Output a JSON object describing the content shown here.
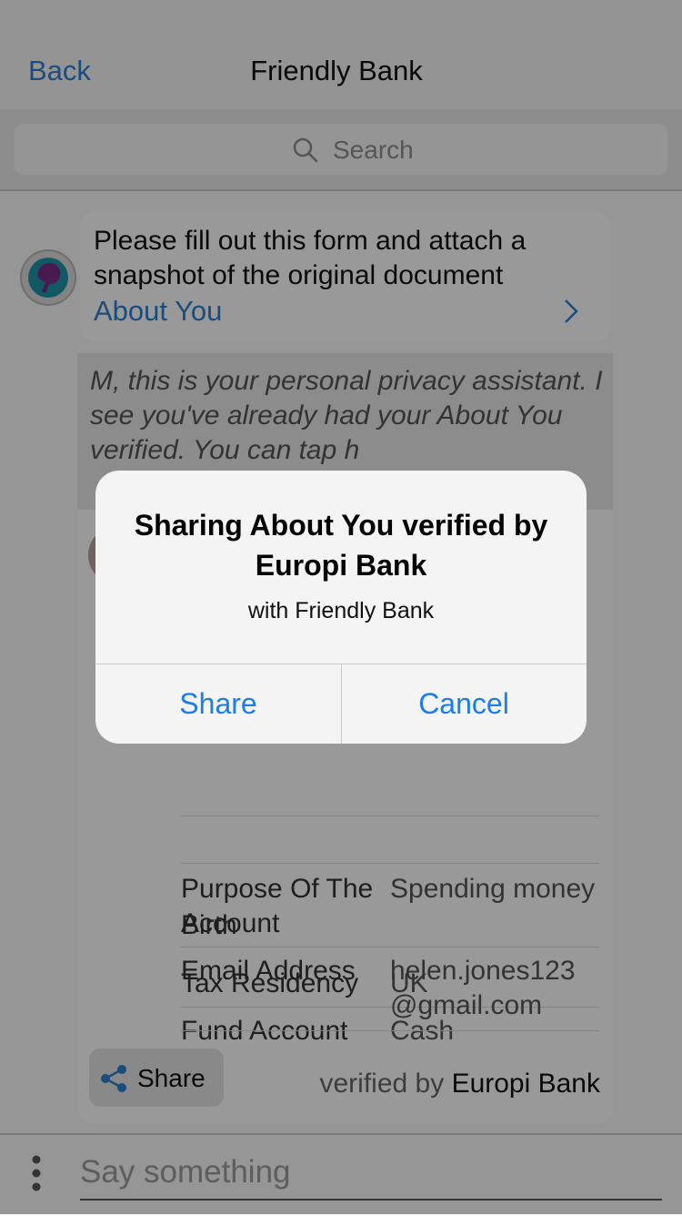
{
  "nav": {
    "back_label": "Back",
    "title": "Friendly Bank"
  },
  "search": {
    "placeholder": "Search"
  },
  "messages": {
    "form_request": {
      "text": "Please fill out this form and attach a snapshot of the original document",
      "link_label": "About You"
    },
    "assistant_note": {
      "text": "M, this is your personal privacy assistant. I see you've already had your About You verified. You can tap h"
    }
  },
  "card": {
    "rows": [
      {
        "key": "Birth",
        "value": ""
      },
      {
        "key": "Tax Residency",
        "value": "UK"
      },
      {
        "key": "Fund Account",
        "value": "Cash"
      },
      {
        "key": "Purpose Of The Account",
        "value": "Spending money"
      },
      {
        "key": "Email Address",
        "value": "helen.jones123 @gmail.com"
      }
    ],
    "share_label": "Share",
    "verified_prefix": "verified by",
    "verified_bank": "Europi Bank"
  },
  "composer": {
    "placeholder": "Say something"
  },
  "alert": {
    "title": "Sharing About You verified by Europi Bank",
    "message": "with Friendly Bank",
    "share_label": "Share",
    "cancel_label": "Cancel"
  },
  "colors": {
    "link_blue": "#2f7fd1",
    "alert_button_blue": "#1a7df2",
    "dim_overlay": "rgba(0,0,0,0.4)"
  }
}
